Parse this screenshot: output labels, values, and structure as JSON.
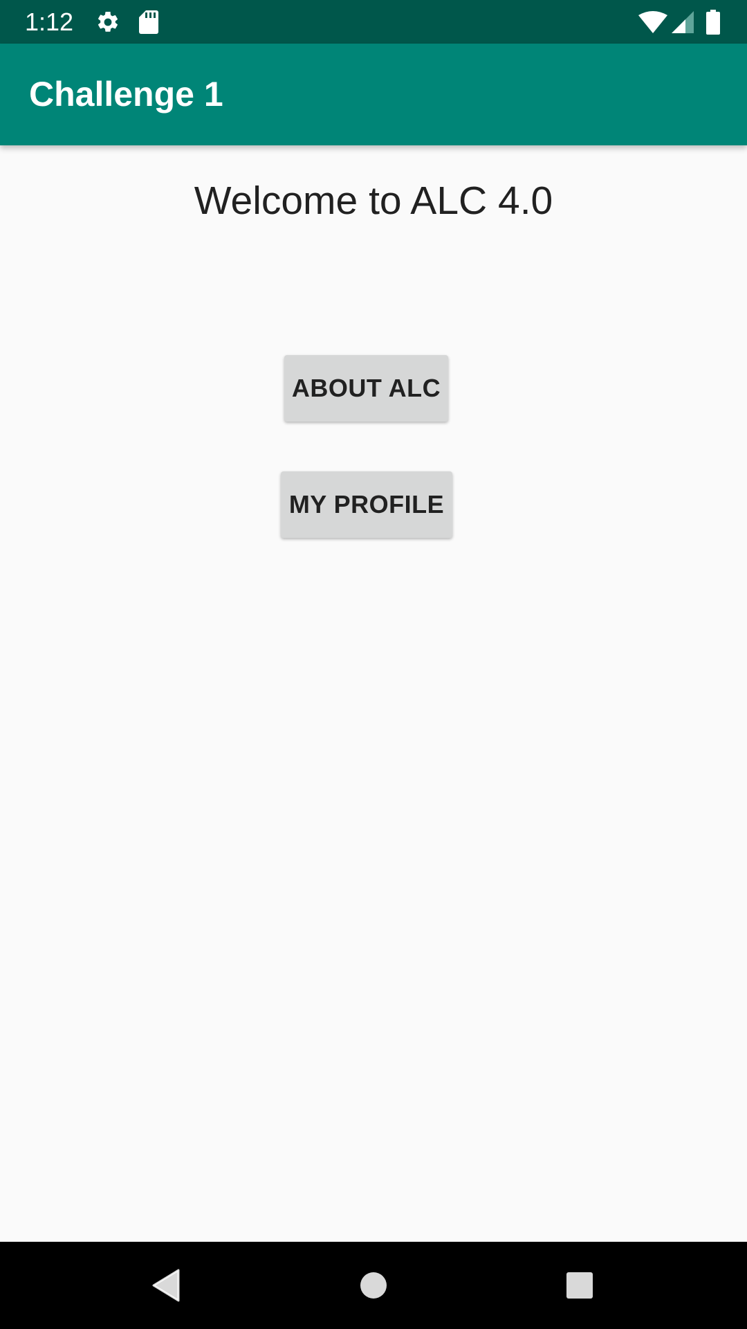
{
  "status_bar": {
    "time": "1:12",
    "icons": [
      "gear-icon",
      "sd-card-icon",
      "wifi-icon",
      "signal-icon",
      "battery-icon"
    ]
  },
  "app_bar": {
    "title": "Challenge 1"
  },
  "main": {
    "welcome_text": "Welcome to ALC 4.0",
    "about_button_label": "ABOUT ALC",
    "profile_button_label": "MY PROFILE"
  },
  "nav_bar": {
    "icons": [
      "back-icon",
      "home-icon",
      "recents-icon"
    ]
  },
  "colors": {
    "status_bar": "#00574B",
    "app_bar": "#008577",
    "background": "#FAFAFA",
    "button": "#D6D7D7",
    "text": "#212121"
  }
}
